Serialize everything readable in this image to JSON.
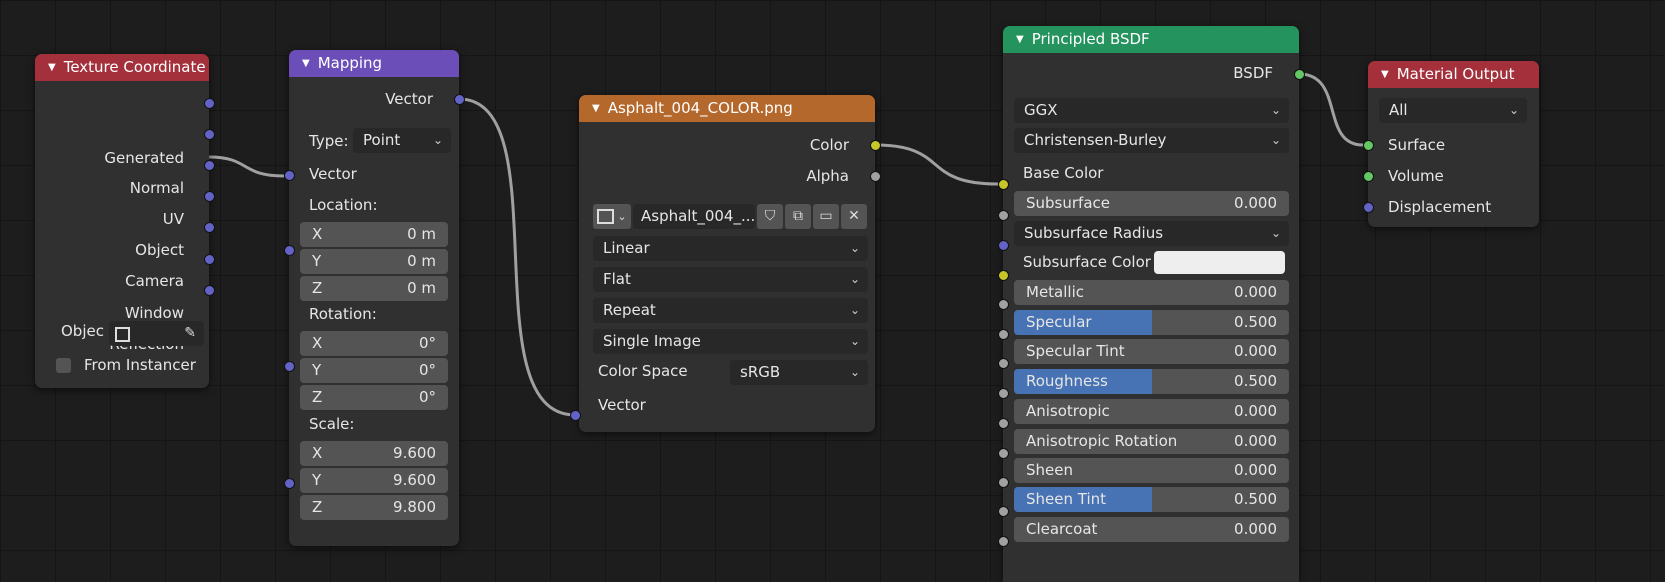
{
  "colors": {
    "background": "#1d1d1d",
    "node_body": "#303030",
    "header_texcoord": "#a3303b",
    "header_mapping": "#6c4eb9",
    "header_image": "#b5682c",
    "header_bsdf": "#25935e",
    "header_output": "#a3303b",
    "socket_vector": "#6363c7",
    "socket_color": "#c7c729",
    "socket_float": "#a1a1a1",
    "socket_shader": "#63c763",
    "slider_fill": "#4772b3",
    "wire": "#a0a0a0"
  },
  "texcoord": {
    "title": "Texture Coordinate",
    "outputs": [
      "Generated",
      "Normal",
      "UV",
      "Object",
      "Camera",
      "Window",
      "Reflection"
    ],
    "object_label": "Objec",
    "from_instancer": "From Instancer"
  },
  "mapping": {
    "title": "Mapping",
    "output": "Vector",
    "type_label": "Type:",
    "type_value": "Point",
    "input": "Vector",
    "location_label": "Location:",
    "location": [
      {
        "axis": "X",
        "value": "0 m"
      },
      {
        "axis": "Y",
        "value": "0 m"
      },
      {
        "axis": "Z",
        "value": "0 m"
      }
    ],
    "rotation_label": "Rotation:",
    "rotation": [
      {
        "axis": "X",
        "value": "0°"
      },
      {
        "axis": "Y",
        "value": "0°"
      },
      {
        "axis": "Z",
        "value": "0°"
      }
    ],
    "scale_label": "Scale:",
    "scale": [
      {
        "axis": "X",
        "value": "9.600"
      },
      {
        "axis": "Y",
        "value": "9.600"
      },
      {
        "axis": "Z",
        "value": "9.800"
      }
    ]
  },
  "image": {
    "title": "Asphalt_004_COLOR.png",
    "out_color": "Color",
    "out_alpha": "Alpha",
    "image_name": "Asphalt_004_...",
    "interpolation": "Linear",
    "projection": "Flat",
    "extension": "Repeat",
    "source": "Single Image",
    "colorspace_label": "Color Space",
    "colorspace_value": "sRGB",
    "input": "Vector"
  },
  "bsdf": {
    "title": "Principled BSDF",
    "output": "BSDF",
    "distribution": "GGX",
    "subsurface_method": "Christensen-Burley",
    "base_color": "Base Color",
    "subsurface_label": "Subsurface",
    "subsurface_value": "0.000",
    "subsurface_radius": "Subsurface Radius",
    "subsurface_color": "Subsurface Color",
    "subsurface_color_value": "#eeeeee",
    "metallic_label": "Metallic",
    "metallic_value": "0.000",
    "specular_label": "Specular",
    "specular_value": "0.500",
    "specular_fraction": 0.5,
    "specular_tint_label": "Specular Tint",
    "specular_tint_value": "0.000",
    "roughness_label": "Roughness",
    "roughness_value": "0.500",
    "roughness_fraction": 0.5,
    "anisotropic_label": "Anisotropic",
    "anisotropic_value": "0.000",
    "aniso_rot_label": "Anisotropic Rotation",
    "aniso_rot_value": "0.000",
    "sheen_label": "Sheen",
    "sheen_value": "0.000",
    "sheen_tint_label": "Sheen Tint",
    "sheen_tint_value": "0.500",
    "sheen_tint_fraction": 0.5,
    "clearcoat_label": "Clearcoat",
    "clearcoat_value": "0.000"
  },
  "output": {
    "title": "Material Output",
    "target": "All",
    "inputs": [
      "Surface",
      "Volume",
      "Displacement"
    ]
  }
}
